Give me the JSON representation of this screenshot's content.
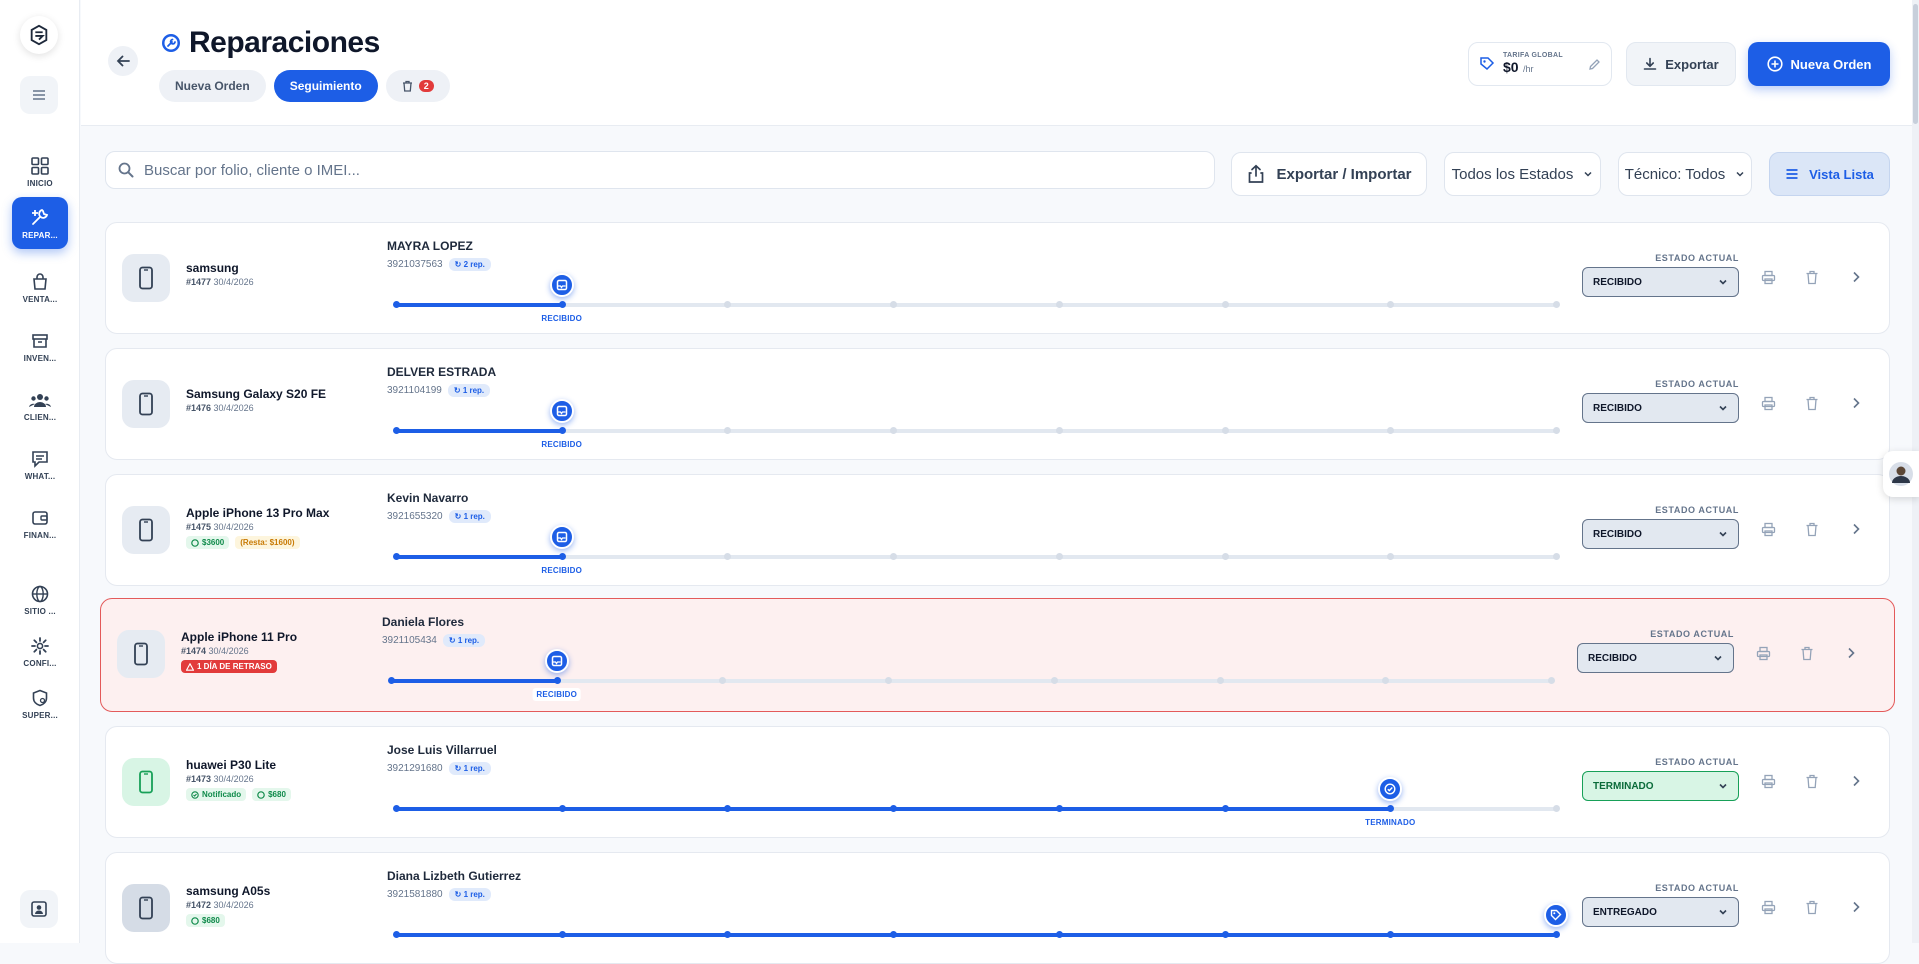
{
  "app": {
    "title": "Reparaciones"
  },
  "sidebar": {
    "items": [
      {
        "label": "INICIO",
        "icon": "grid-icon"
      },
      {
        "label": "REPAR...",
        "icon": "tools-icon",
        "active": true
      },
      {
        "label": "VENTA...",
        "icon": "bag-icon"
      },
      {
        "label": "INVEN...",
        "icon": "box-icon"
      },
      {
        "label": "CLIEN...",
        "icon": "users-icon"
      },
      {
        "label": "WHAT...",
        "icon": "chat-icon"
      },
      {
        "label": "FINAN...",
        "icon": "wallet-icon"
      },
      {
        "label": "SITIO ...",
        "icon": "globe-icon"
      },
      {
        "label": "CONFI...",
        "icon": "gear-icon"
      },
      {
        "label": "SUPER...",
        "icon": "shield-icon"
      }
    ]
  },
  "header": {
    "tabs": [
      {
        "label": "Nueva Orden"
      },
      {
        "label": "Seguimiento",
        "active": true
      }
    ],
    "trash_count": "2",
    "tarifa": {
      "label": "TARIFA GLOBAL",
      "value": "$0",
      "unit": "/hr"
    },
    "export_label": "Exportar",
    "new_order_label": "Nueva Orden"
  },
  "toolbar": {
    "search_placeholder": "Buscar por folio, cliente o IMEI...",
    "export_import_label": "Exportar / Importar",
    "status_filter": "Todos los Estados",
    "tech_filter": "Técnico: Todos",
    "view_label": "Vista Lista"
  },
  "estado_label": "ESTADO ACTUAL",
  "orders": [
    {
      "device": "samsung",
      "folio": "#1477",
      "date": "30/4/2026",
      "client": "MAYRA LOPEZ",
      "phone": "3921037563",
      "reps": "2 rep.",
      "stage": "RECIBIDO",
      "status": "RECIBIDO",
      "progress": 1,
      "chips": []
    },
    {
      "device": "Samsung Galaxy S20 FE",
      "folio": "#1476",
      "date": "30/4/2026",
      "client": "DELVER ESTRADA",
      "phone": "3921104199",
      "reps": "1 rep.",
      "stage": "RECIBIDO",
      "status": "RECIBIDO",
      "progress": 1,
      "chips": []
    },
    {
      "device": "Apple iPhone 13 Pro Max",
      "folio": "#1475",
      "date": "30/4/2026",
      "client": "Kevin Navarro",
      "phone": "3921655320",
      "reps": "1 rep.",
      "stage": "RECIBIDO",
      "status": "RECIBIDO",
      "progress": 1,
      "chips": [
        {
          "type": "money",
          "text": "$3600"
        },
        {
          "type": "resta",
          "text": "(Resta: $1600)"
        }
      ]
    },
    {
      "device": "Apple iPhone 11 Pro",
      "folio": "#1474",
      "date": "30/4/2026",
      "client": "Daniela Flores",
      "phone": "3921105434",
      "reps": "1 rep.",
      "stage": "RECIBIDO",
      "status": "RECIBIDO",
      "progress": 1,
      "late": true,
      "chips": [
        {
          "type": "late",
          "text": "1 DÍA DE RETRASO"
        }
      ]
    },
    {
      "device": "huawei P30 Lite",
      "folio": "#1473",
      "date": "30/4/2026",
      "client": "Jose Luis Villarruel",
      "phone": "3921291680",
      "reps": "1 rep.",
      "stage": "TERMINADO",
      "status": "TERMINADO",
      "progress": 6,
      "chips": [
        {
          "type": "notif",
          "text": "Notificado"
        },
        {
          "type": "money",
          "text": "$680"
        }
      ]
    },
    {
      "device": "samsung A05s",
      "folio": "#1472",
      "date": "30/4/2026",
      "client": "Diana Lizbeth Gutierrez",
      "phone": "3921581880",
      "reps": "1 rep.",
      "stage": "",
      "status": "ENTREGADO",
      "progress": 7,
      "chips": [
        {
          "type": "money",
          "text": "$680"
        }
      ]
    }
  ],
  "colors": {
    "accent": "#1d5ee6",
    "danger": "#e23b3b",
    "success": "#17a058"
  }
}
